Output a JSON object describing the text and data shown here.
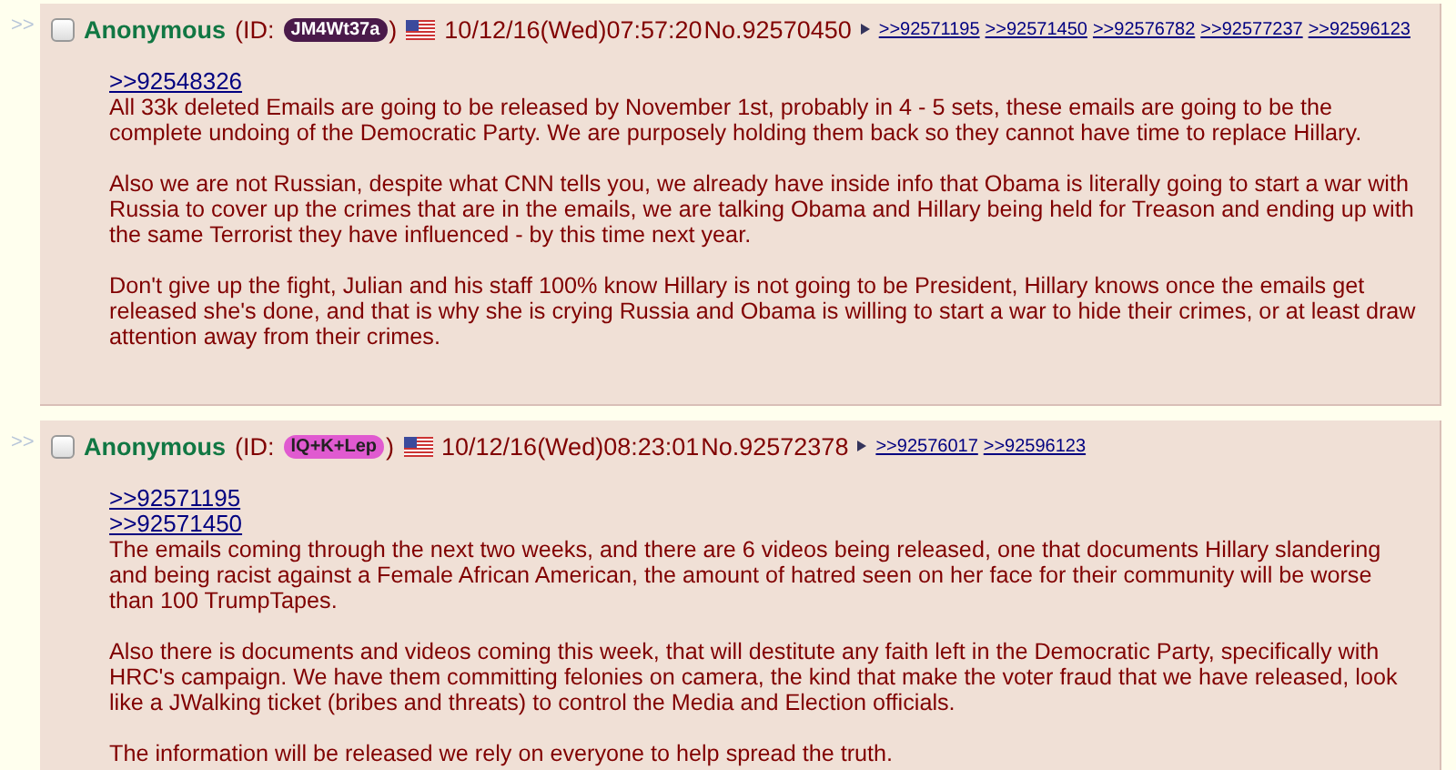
{
  "posts": [
    {
      "side_mark": ">>",
      "checked": false,
      "name": "Anonymous",
      "id_open": "(ID:",
      "id": {
        "text": "JM4Wt37a",
        "color": "#4a1a4a"
      },
      "id_close": ")",
      "date": "10/12/16(Wed)07:57:20",
      "number": "No.92570450",
      "backlinks": [
        ">>92571195",
        ">>92571450",
        ">>92576782",
        ">>92577237",
        ">>92596123"
      ],
      "quotelinks": [
        ">>92548326"
      ],
      "paragraphs": [
        "All 33k deleted Emails are going to be released by November 1st, probably in 4 - 5 sets, these emails are going to be the complete undoing of the Democratic Party. We are purposely holding them back so they cannot have time to replace Hillary.",
        "Also we are not Russian, despite what CNN tells you, we already have inside info that Obama is literally going to start a war with Russia to cover up the crimes that are in the emails, we are talking Obama and Hillary being held for Treason and ending up with the same Terrorist they have influenced - by this time next year.",
        "Don't give up the fight, Julian and his staff 100% know Hillary is not going to be President, Hillary knows once the emails get released she's done, and that is why she is crying Russia and Obama is willing to start a war to hide their crimes, or at least draw attention away from their crimes."
      ]
    },
    {
      "side_mark": ">>",
      "checked": false,
      "name": "Anonymous",
      "id_open": "(ID:",
      "id": {
        "text": "lQ+K+Lep",
        "color": "#e05ad0"
      },
      "id_close": ")",
      "date": "10/12/16(Wed)08:23:01",
      "number": "No.92572378",
      "backlinks": [
        ">>92576017",
        ">>92596123"
      ],
      "quotelinks": [
        ">>92571195",
        ">>92571450"
      ],
      "paragraphs": [
        "The emails coming through the next two weeks, and there are 6 videos being released, one that documents Hillary slandering and being racist against a Female African American, the amount of hatred seen on her face for their community will be worse than 100 TrumpTapes.",
        "Also there is documents and videos coming this week, that will destitute any faith left in the Democratic Party, specifically with HRC's campaign. We have them committing felonies on camera, the kind that make the voter fraud that we have released, look like a JWalking ticket (bribes and threats) to control the Media and Election officials.",
        "The information will be released we rely on everyone to help spread the truth."
      ]
    }
  ]
}
